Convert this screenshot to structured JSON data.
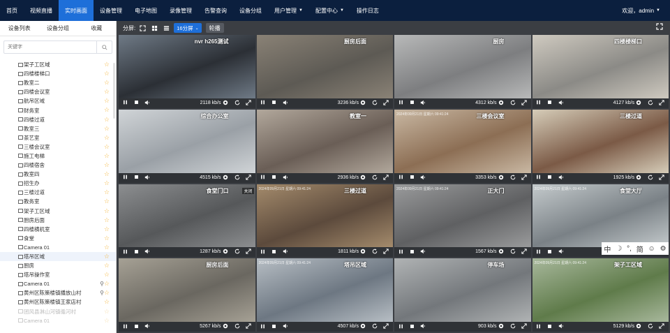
{
  "nav": {
    "items": [
      {
        "label": "首页"
      },
      {
        "label": "视频直播"
      },
      {
        "label": "实时画面",
        "active": true
      },
      {
        "label": "设备管理"
      },
      {
        "label": "电子地图"
      },
      {
        "label": "录像管理"
      },
      {
        "label": "告警查询"
      },
      {
        "label": "设备分组"
      },
      {
        "label": "用户管理",
        "caret": true
      },
      {
        "label": "配置中心",
        "caret": true
      },
      {
        "label": "操作日志"
      }
    ],
    "user": "欢迎，admin"
  },
  "sidebar": {
    "tabs": [
      "设备列表",
      "设备分组",
      "收藏"
    ],
    "search_placeholder": "关键字",
    "items": [
      {
        "label": "架子工区域",
        "star": true
      },
      {
        "label": "四楼楼梯口",
        "star": true
      },
      {
        "label": "教室二",
        "star": true
      },
      {
        "label": "四楼会议室",
        "star": true
      },
      {
        "label": "航吊区域",
        "star": true
      },
      {
        "label": "财务室",
        "star": true
      },
      {
        "label": "四楼过道",
        "star": true
      },
      {
        "label": "教室三",
        "star": true
      },
      {
        "label": "茶艺室",
        "star": true
      },
      {
        "label": "三楼会议室",
        "star": true
      },
      {
        "label": "施工电梯",
        "star": true
      },
      {
        "label": "四楼宿舍",
        "star": true
      },
      {
        "label": "教室四",
        "star": true
      },
      {
        "label": "招生办",
        "star": true
      },
      {
        "label": "三楼过道",
        "star": true
      },
      {
        "label": "教务室",
        "star": true
      },
      {
        "label": "架子工区域",
        "star": true
      },
      {
        "label": "厨房后面",
        "star": true
      },
      {
        "label": "四楼横机室",
        "star": true
      },
      {
        "label": "食堂",
        "star": true
      },
      {
        "label": "Camera 01",
        "star": true
      },
      {
        "label": "塔吊区域",
        "star": true,
        "selected": true
      },
      {
        "label": "厨房",
        "star": true
      },
      {
        "label": "塔吊操作室",
        "star": true
      },
      {
        "label": "Camera 01",
        "star": true,
        "pin": true
      },
      {
        "label": "黄州区陈策楼镇播放山村",
        "star": true,
        "pin": true
      },
      {
        "label": "黄州区陈策楼镇王家店村",
        "star": true
      },
      {
        "label": "团风县淋山河镇循河村",
        "star": true,
        "faded": true
      },
      {
        "label": "Camera 01",
        "star": true,
        "faded": true
      }
    ]
  },
  "toolbar": {
    "split_label": "分屏:",
    "split_value": "16分屏",
    "poll_label": "轮播"
  },
  "cameras": [
    {
      "name": "nvr h265测试",
      "bitrate": "2118 kb/s",
      "bg": "#2b2f35",
      "bg2": "#6f7a86",
      "ts": ""
    },
    {
      "name": "厨房后面",
      "bitrate": "3236 kb/s",
      "bg": "#5d5a54",
      "bg2": "#8a8276",
      "ts": ""
    },
    {
      "name": "厨房",
      "bitrate": "4312 kb/s",
      "bg": "#7d7e80",
      "bg2": "#b8b9b9",
      "ts": ""
    },
    {
      "name": "四楼楼梯口",
      "bitrate": "4127 kb/s",
      "bg": "#8b8a86",
      "bg2": "#cfcac0",
      "ts": ""
    },
    {
      "name": "综合办公室",
      "bitrate": "4515 kb/s",
      "bg": "#9aa0a6",
      "bg2": "#d0d4d7",
      "ts": ""
    },
    {
      "name": "教室一",
      "bitrate": "2936 kb/s",
      "bg": "#6a5e56",
      "bg2": "#b2a89c",
      "ts": ""
    },
    {
      "name": "三楼会议室",
      "bitrate": "3353 kb/s",
      "bg": "#8c6e54",
      "bg2": "#c9b8a3",
      "ts": "2024年09月21日 星期六 09:41:24"
    },
    {
      "name": "三楼过道",
      "bitrate": "1925 kb/s",
      "bg": "#7b5a46",
      "bg2": "#d6cdb9",
      "ts": ""
    },
    {
      "name": "食堂门口",
      "bitrate": "1287 kb/s",
      "bg": "#56585a",
      "bg2": "#8c8e90",
      "ts": "",
      "closed": "关闭"
    },
    {
      "name": "三楼过道",
      "bitrate": "1811 kb/s",
      "bg": "#5c4a3c",
      "bg2": "#a48b6c",
      "ts": "2024年09月21日 星期六 09:41:24"
    },
    {
      "name": "正大门",
      "bitrate": "1567 kb/s",
      "bg": "#5f6062",
      "bg2": "#9a9b9c",
      "ts": "2024年09月21日 星期六 09:41:24"
    },
    {
      "name": "食堂大厅",
      "bitrate": "",
      "bg": "#7a8186",
      "bg2": "#c4cacc",
      "ts": "2024年09月21日 星期六 09:41:24"
    },
    {
      "name": "厨房后面",
      "bitrate": "5267 kb/s",
      "bg": "#6a6760",
      "bg2": "#a6a195",
      "ts": ""
    },
    {
      "name": "塔吊区域",
      "bitrate": "4507 kb/s",
      "bg": "#6d7782",
      "bg2": "#b7bec4",
      "ts": "2024年09月21日 星期六 09:41:24"
    },
    {
      "name": "停车场",
      "bitrate": "903 kb/s",
      "bg": "#73777b",
      "bg2": "#b0b3b4",
      "ts": "",
      "selected": true
    },
    {
      "name": "架子工区域",
      "bitrate": "5129 kb/s",
      "bg": "#5f7b4a",
      "bg2": "#a8b89c",
      "ts": "2024年09月21日 星期六 09:41:24"
    }
  ],
  "ime": [
    "中",
    "☽",
    "°,",
    "简",
    "☺",
    "⚙"
  ]
}
